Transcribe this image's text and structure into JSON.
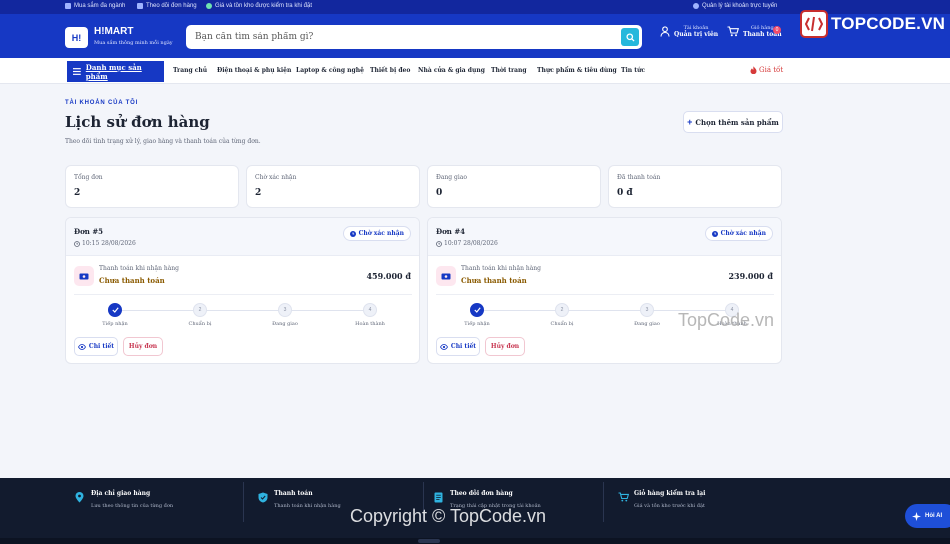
{
  "topbar": {
    "items": [
      "Mua sắm đa ngành",
      "Theo dõi đơn hàng",
      "Giá và tồn kho được kiểm tra khi đặt"
    ],
    "right_link": "Quản lý tài khoản trực tuyến"
  },
  "header": {
    "logo_mark": "H!",
    "brand": "H!MART",
    "tagline": "Mua sắm thông minh mỗi ngày",
    "search_placeholder": "Bạn cần tìm sản phẩm gì?",
    "account_label": "Tài khoản",
    "account_name": "Quản trị viên",
    "cart_label": "Giỏ hàng",
    "cart_action": "Thanh toán",
    "cart_count": "0"
  },
  "nav": {
    "category_button": "Danh mục sản phẩm",
    "items": [
      "Trang chủ",
      "Điện thoại & phụ kiện",
      "Laptop & công nghệ",
      "Thiết bị đeo",
      "Nhà cửa & gia dụng",
      "Thời trang",
      "Thực phẩm & tiêu dùng",
      "Tin tức"
    ],
    "hot_deals": "Giá tốt"
  },
  "page": {
    "overline": "TÀI KHOẢN CỦA TÔI",
    "title": "Lịch sử đơn hàng",
    "subtitle": "Theo dõi tình trạng xử lý, giao hàng và thanh toán của từng đơn.",
    "add_button": "Chọn thêm sản phẩm"
  },
  "stats": [
    {
      "label": "Tổng đơn",
      "value": "2"
    },
    {
      "label": "Chờ xác nhận",
      "value": "2"
    },
    {
      "label": "Đang giao",
      "value": "0"
    },
    {
      "label": "Đã thanh toán",
      "value": "0 đ"
    }
  ],
  "orders": [
    {
      "id": "Đơn #5",
      "time": "10:15 28/08/2026",
      "status": "Chờ xác nhận",
      "payment_method": "Thanh toán khi nhận hàng",
      "payment_status": "Chưa thanh toán",
      "amount": "459.000 đ",
      "steps": [
        {
          "num": "1",
          "label": "Tiếp nhận",
          "done": true
        },
        {
          "num": "2",
          "label": "Chuẩn bị",
          "done": false
        },
        {
          "num": "3",
          "label": "Đang giao",
          "done": false
        },
        {
          "num": "4",
          "label": "Hoàn thành",
          "done": false
        }
      ],
      "detail_button": "Chi tiết",
      "cancel_button": "Hủy đơn"
    },
    {
      "id": "Đơn #4",
      "time": "10:07 28/08/2026",
      "status": "Chờ xác nhận",
      "payment_method": "Thanh toán khi nhận hàng",
      "payment_status": "Chưa thanh toán",
      "amount": "239.000 đ",
      "steps": [
        {
          "num": "1",
          "label": "Tiếp nhận",
          "done": true
        },
        {
          "num": "2",
          "label": "Chuẩn bị",
          "done": false
        },
        {
          "num": "3",
          "label": "Đang giao",
          "done": false
        },
        {
          "num": "4",
          "label": "Hoàn thành",
          "done": false
        }
      ],
      "detail_button": "Chi tiết",
      "cancel_button": "Hủy đơn"
    }
  ],
  "footer": {
    "items": [
      {
        "title": "Địa chỉ giao hàng",
        "subtitle": "Lưu theo thông tin của từng đơn",
        "icon": "map-pin-icon"
      },
      {
        "title": "Thanh toán",
        "subtitle": "Thanh toán khi nhận hàng",
        "icon": "shield-icon"
      },
      {
        "title": "Theo dõi đơn hàng",
        "subtitle": "Trạng thái cập nhật trong tài khoản",
        "icon": "document-icon"
      },
      {
        "title": "Giỏ hàng kiểm tra lại",
        "subtitle": "Giá và tồn kho trước khi đặt",
        "icon": "cart-icon"
      }
    ]
  },
  "ai_button": "Hỏi AI",
  "watermarks": {
    "logo_text": "TOPCODE.VN",
    "mid": "TopCode.vn",
    "copyright": "Copyright © TopCode.vn"
  },
  "colors": {
    "primary": "#1638c4",
    "topbar": "#12279e",
    "accent_cyan": "#25b8dc",
    "danger": "#c7344f",
    "footer": "#121b2e"
  }
}
